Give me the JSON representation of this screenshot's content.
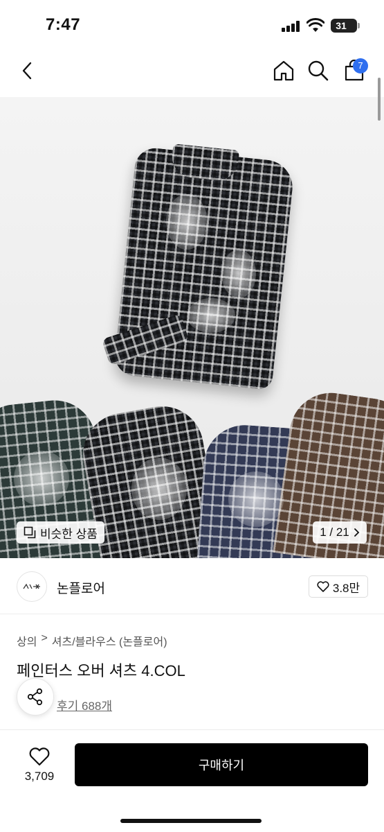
{
  "status_bar": {
    "time": "7:47",
    "battery": "31"
  },
  "nav": {
    "back_icon": "chevron-left-icon",
    "home_icon": "home-icon",
    "search_icon": "search-icon",
    "cart_icon": "cart-icon",
    "cart_count": "7"
  },
  "gallery": {
    "similar_label": "비슷한 상품",
    "page_indicator": "1 / 21"
  },
  "brand": {
    "name": "논플로어",
    "likes": "3.8만"
  },
  "breadcrumb": {
    "level1": "상의",
    "separator": ">",
    "level2": "셔츠/블라우스 (논플로어)"
  },
  "product": {
    "title": "페인터스 오버 셔츠 4.COL",
    "reviews": "후기 688개"
  },
  "bottom": {
    "wish_count": "3,709",
    "buy_label": "구매하기"
  },
  "colors": {
    "accent": "#2f6fef",
    "buy_button": "#000000"
  }
}
